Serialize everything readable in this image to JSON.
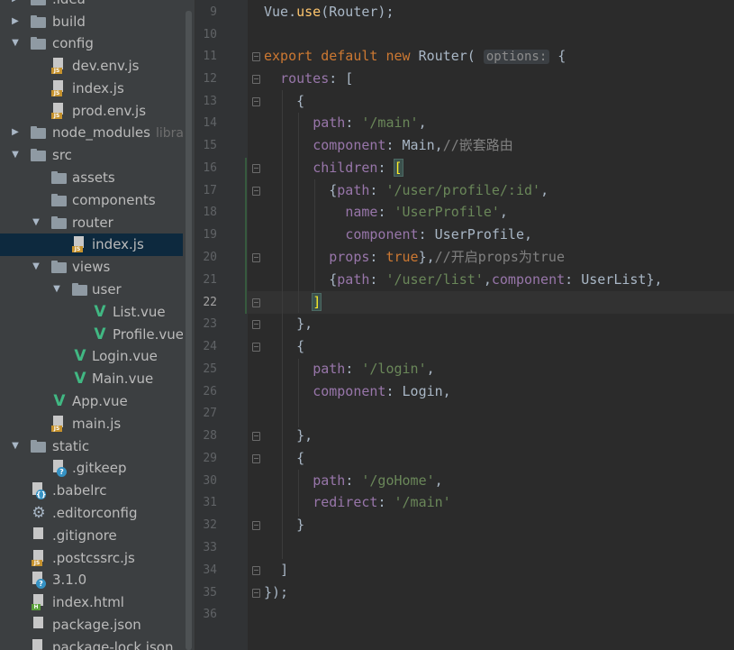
{
  "project_tree": {
    "items": [
      {
        "label": ".idea",
        "type": "folder",
        "expanded": false
      },
      {
        "label": "build",
        "type": "folder",
        "expanded": false
      },
      {
        "label": "config",
        "type": "folder",
        "expanded": true
      },
      {
        "label": "dev.env.js",
        "type": "js"
      },
      {
        "label": "index.js",
        "type": "js"
      },
      {
        "label": "prod.env.js",
        "type": "js"
      },
      {
        "label": "node_modules",
        "type": "folder",
        "expanded": false,
        "note": "library r"
      },
      {
        "label": "src",
        "type": "folder",
        "expanded": true
      },
      {
        "label": "assets",
        "type": "folder"
      },
      {
        "label": "components",
        "type": "folder"
      },
      {
        "label": "router",
        "type": "folder",
        "expanded": true
      },
      {
        "label": "index.js",
        "type": "js",
        "selected": true
      },
      {
        "label": "views",
        "type": "folder",
        "expanded": true
      },
      {
        "label": "user",
        "type": "folder",
        "expanded": true
      },
      {
        "label": "List.vue",
        "type": "vue"
      },
      {
        "label": "Profile.vue",
        "type": "vue"
      },
      {
        "label": "Login.vue",
        "type": "vue"
      },
      {
        "label": "Main.vue",
        "type": "vue"
      },
      {
        "label": "App.vue",
        "type": "vue"
      },
      {
        "label": "main.js",
        "type": "js"
      },
      {
        "label": "static",
        "type": "folder",
        "expanded": true
      },
      {
        "label": ".gitkeep",
        "type": "config-file"
      },
      {
        "label": ".babelrc",
        "type": "config-file"
      },
      {
        "label": ".editorconfig",
        "type": "gear"
      },
      {
        "label": ".gitignore",
        "type": "js"
      },
      {
        "label": ".postcssrc.js",
        "type": "js"
      },
      {
        "label": "3.1.0",
        "type": "config-file"
      },
      {
        "label": "index.html",
        "type": "html"
      },
      {
        "label": "package.json",
        "type": "json"
      },
      {
        "label": "package-lock.json",
        "type": "json"
      }
    ]
  },
  "editor": {
    "current_line": 22,
    "line_numbers": [
      "9",
      "10",
      "11",
      "12",
      "13",
      "14",
      "15",
      "16",
      "17",
      "18",
      "19",
      "20",
      "21",
      "22",
      "23",
      "24",
      "25",
      "26",
      "27",
      "28",
      "29",
      "30",
      "31",
      "32",
      "33",
      "34",
      "35",
      "36"
    ],
    "code": {
      "l9_a": "Vue",
      "l9_b": ".",
      "l9_c": "use",
      "l9_d": "(Router);",
      "l11_export": "export",
      "l11_default": "default",
      "l11_new": "new",
      "l11_router": "Router(",
      "l11_hint": "options:",
      "l11_brace": " {",
      "l12_routes": "routes",
      "l12_rest": ": [",
      "l13": "{",
      "l14_path": "path",
      "l14_colon": ": ",
      "l14_val": "'/main'",
      "l14_comma": ",",
      "l15_comp": "component",
      "l15_rest": ": Main,",
      "l15_cmt": "//嵌套路由",
      "l16_children": "children",
      "l16_colon": ": ",
      "l16_bracket": "[",
      "l17_open": "{",
      "l17_path": "path",
      "l17_colon": ": ",
      "l17_val": "'/user/profile/:id'",
      "l17_comma": ",",
      "l18_name": "name",
      "l18_colon": ": ",
      "l18_val": "'UserProfile'",
      "l18_comma": ",",
      "l19_comp": "component",
      "l19_rest": ": UserProfile,",
      "l20_props": "props",
      "l20_colon": ": ",
      "l20_val": "true",
      "l20_rest": "},",
      "l20_cmt": "//开启props为true",
      "l21_open": "{",
      "l21_path": "path",
      "l21_colon": ": ",
      "l21_val": "'/user/list'",
      "l21_comma": ",",
      "l21_comp": "component",
      "l21_rest": ": UserList},",
      "l22_bracket": "]",
      "l23": "},",
      "l24": "{",
      "l25_path": "path",
      "l25_colon": ": ",
      "l25_val": "'/login'",
      "l25_comma": ",",
      "l26_comp": "component",
      "l26_rest": ": Login,",
      "l28": "},",
      "l29": "{",
      "l30_path": "path",
      "l30_colon": ": ",
      "l30_val": "'/goHome'",
      "l30_comma": ",",
      "l31_redirect": "redirect",
      "l31_colon": ": ",
      "l31_val": "'/main'",
      "l32": "}",
      "l34": "]",
      "l35": "});"
    }
  },
  "colors": {
    "background": "#2b2b2b",
    "tree_background": "#3c3f41",
    "selection": "#0d293e",
    "keyword": "#cc7832",
    "string": "#6a8759",
    "property": "#9876aa",
    "function": "#ffc66d",
    "comment": "#808080",
    "vue": "#41b883"
  }
}
